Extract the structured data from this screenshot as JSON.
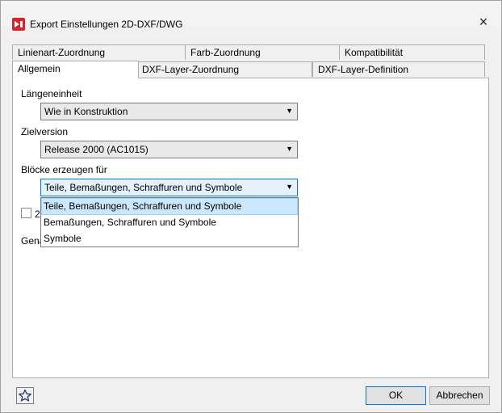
{
  "window": {
    "title": "Export Einstellungen 2D-DXF/DWG",
    "close_icon": "×"
  },
  "tabs_row1": [
    "Linienart-Zuordnung",
    "Farb-Zuordnung",
    "Kompatibilität"
  ],
  "tabs_row2": [
    "Allgemein",
    "DXF-Layer-Zuordnung",
    "DXF-Layer-Definition"
  ],
  "form": {
    "laengeneinheit_label": "Längeneinheit",
    "laengeneinheit_value": "Wie in Konstruktion",
    "zielversion_label": "Zielversion",
    "zielversion_value": "Release 2000 (AC1015)",
    "bloecke_label": "Blöcke erzeugen für",
    "bloecke_value": "Teile, Bemaßungen, Schraffuren und Symbole",
    "dropdown_arrow": "▼",
    "checkbox_partial_label": "2",
    "gena_partial_label": "Gena"
  },
  "dropdown_options": [
    "Teile, Bemaßungen, Schraffuren und Symbole",
    "Bemaßungen, Schraffuren und Symbole",
    "Symbole"
  ],
  "buttons": {
    "ok": "OK",
    "cancel": "Abbrechen"
  },
  "icons": {
    "app": "app-logo-icon",
    "favorite": "star-icon"
  },
  "colors": {
    "selection": "#cce8ff",
    "accent": "#0078d7",
    "app_icon_red": "#d3262b"
  }
}
